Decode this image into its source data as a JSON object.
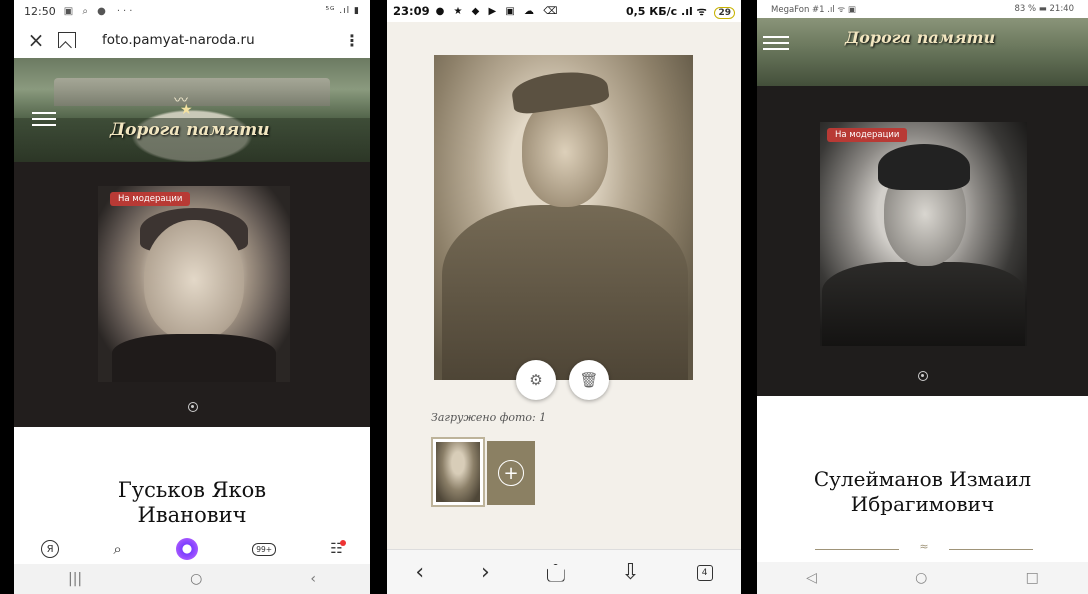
{
  "phone1": {
    "status": {
      "time": "12:50",
      "icons": "▣ ⌕ ●",
      "more": "···",
      "right": "⁵ᴳ .ıl ▮"
    },
    "url": "foto.pamyat-naroda.ru",
    "banner_title": "Дорога памяти",
    "badge": "На модерации",
    "name": "Гуськов Яков Иванович",
    "nav": {
      "yandex": "Я",
      "search": "⌕",
      "tabs": "99+",
      "services": "☷"
    },
    "sys": {
      "recent": "|||",
      "home": "○",
      "back": "‹"
    }
  },
  "phone2": {
    "status": {
      "time": "23:09",
      "icons": "● ★ ◆ ▶ ▣ ☁ ⌫",
      "speed": "0,5 КБ/с",
      "net": ".ıl ᯤ",
      "battery": "29"
    },
    "uploaded": "Загружено фото: 1",
    "add": "+",
    "nav": {
      "back": "‹",
      "forward": "›",
      "download": "⇩",
      "tabs": "4"
    }
  },
  "phone3": {
    "status": {
      "left": "MegaFon #1 .ıl ᯤ ▣",
      "right": "83 % ▬ 21:40"
    },
    "banner_title": "Дорога памяти",
    "badge": "На модерации",
    "name_line1": "Сулейманов Измаил",
    "name_line2": "Ибрагимович",
    "ornament": "≈",
    "sys": {
      "back": "◁",
      "home": "○",
      "recent": "□"
    }
  },
  "colors": {
    "badge": "#b83a35",
    "add_button": "#8b8063",
    "dark_panel": "#221e1d"
  }
}
